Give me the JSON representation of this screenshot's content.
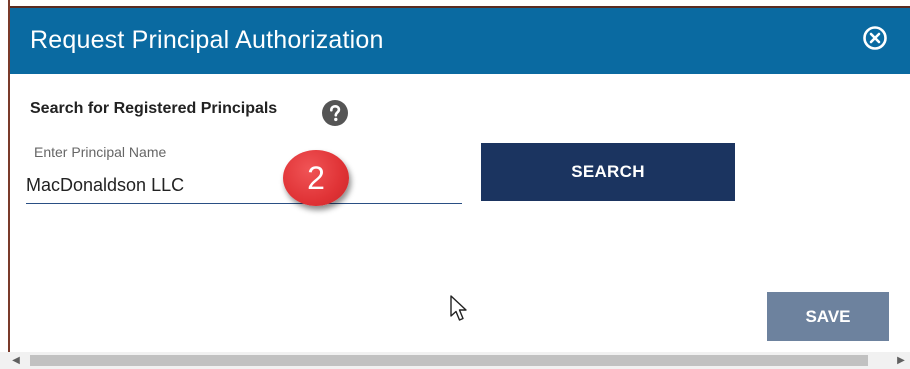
{
  "dialog": {
    "title": "Request Principal Authorization",
    "close_icon": "circle-x-icon",
    "header_color": "#0a6aa1"
  },
  "search_section": {
    "label": "Search for Registered Principals",
    "help_icon": "question-circle-icon"
  },
  "principal_field": {
    "label": "Enter Principal Name",
    "value": "MacDonaldson LLC"
  },
  "step_badge": {
    "text": "2",
    "color": "#e03336"
  },
  "buttons": {
    "search_label": "SEARCH",
    "search_color": "#1b3460",
    "save_label": "SAVE",
    "save_color": "#6d829e"
  },
  "scrollbar": {
    "left_arrow": "◀",
    "right_arrow": "▶"
  }
}
